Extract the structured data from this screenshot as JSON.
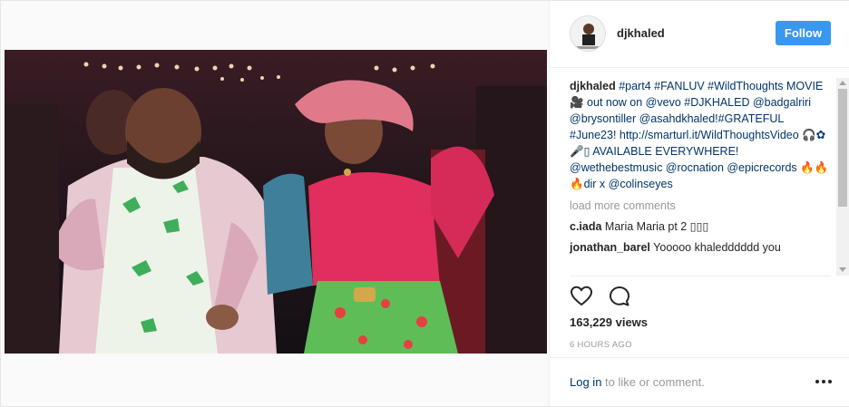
{
  "post": {
    "username": "djkhaled",
    "follow_label": "Follow",
    "caption": {
      "user": "djkhaled",
      "text_1": "#part4 #FANLUV #WildThoughts MOVIE",
      "emoji_camera": "🎥",
      "text_2": " out now on @vevo #DJKHALED @badgalriri @brysontiller @asahdkhaled!#GRATEFUL #June23! http://smarturl.it/WildThoughtsVideo 🎧✿ 🎤▯ AVAILABLE EVERYWHERE! @wethebestmusic @rocnation @epicrecords 🔥🔥🔥dir x @colinseyes"
    },
    "load_more": "load more comments",
    "comments": [
      {
        "user": "c.iada",
        "text": "Maria Maria pt 2 ▯▯▯"
      },
      {
        "user": "jonathan_barel",
        "text": "Yooooo khaledddddd you"
      }
    ],
    "views": "163,229 views",
    "time": "6 HOURS AGO",
    "login_link": "Log in",
    "login_rest": " to like or comment.",
    "icons": {
      "like": "heart-icon",
      "comment": "comment-bubble-icon",
      "more": "more-options-icon"
    },
    "colors": {
      "accent": "#3897f0",
      "link": "#003569",
      "muted": "#999999"
    }
  }
}
